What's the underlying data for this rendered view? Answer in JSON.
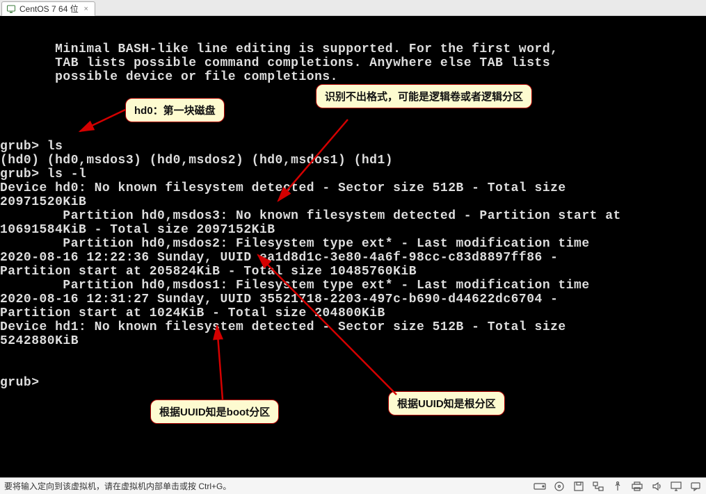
{
  "tab": {
    "label": "CentOS 7 64 位"
  },
  "terminal_lines": [
    "",
    "       Minimal BASH-like line editing is supported. For the first word,",
    "       TAB lists possible command completions. Anywhere else TAB lists",
    "       possible device or file completions.",
    "",
    "",
    "",
    "",
    "grub> ls",
    "(hd0) (hd0,msdos3) (hd0,msdos2) (hd0,msdos1) (hd1)",
    "grub> ls -l",
    "Device hd0: No known filesystem detected - Sector size 512B - Total size",
    "20971520KiB",
    "        Partition hd0,msdos3: No known filesystem detected - Partition start at",
    "10691584KiB - Total size 2097152KiB",
    "        Partition hd0,msdos2: Filesystem type ext* - Last modification time",
    "2020-08-16 12:22:36 Sunday, UUID ea1d8d1c-3e80-4a6f-98cc-c83d8897ff86 -",
    "Partition start at 205824KiB - Total size 10485760KiB",
    "        Partition hd0,msdos1: Filesystem type ext* - Last modification time",
    "2020-08-16 12:31:27 Sunday, UUID 35521718-2203-497c-b690-d44622dc6704 -",
    "Partition start at 1024KiB - Total size 204800KiB",
    "Device hd1: No known filesystem detected - Sector size 512B - Total size",
    "5242880KiB",
    "",
    "",
    "grub>"
  ],
  "callouts": {
    "c1": "hd0：第一块磁盘",
    "c2": "识别不出格式，可能是逻辑卷或者逻辑分区",
    "c3": "根据UUID知是boot分区",
    "c4": "根据UUID知是根分区"
  },
  "statusbar": {
    "hint": "要将输入定向到该虚拟机，请在虚拟机内部单击或按 Ctrl+G。"
  }
}
